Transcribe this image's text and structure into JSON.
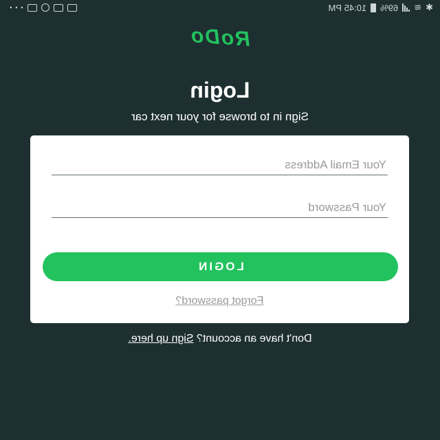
{
  "status_bar": {
    "time": "10:45 PM",
    "battery_percent": "69%",
    "more": "···"
  },
  "app": {
    "logo_text": "RoDo",
    "brand_color": "#22c35e",
    "background_color": "#1e2f31"
  },
  "login": {
    "title": "Login",
    "subtitle": "Sign in to browse for your next car",
    "email_placeholder": "Your Email Address",
    "password_placeholder": "Your Password",
    "button_label": "LOGIN",
    "forgot_label": "Forgot password?"
  },
  "signup": {
    "prompt": "Don't have an account?",
    "link_label": "Sign up here."
  }
}
